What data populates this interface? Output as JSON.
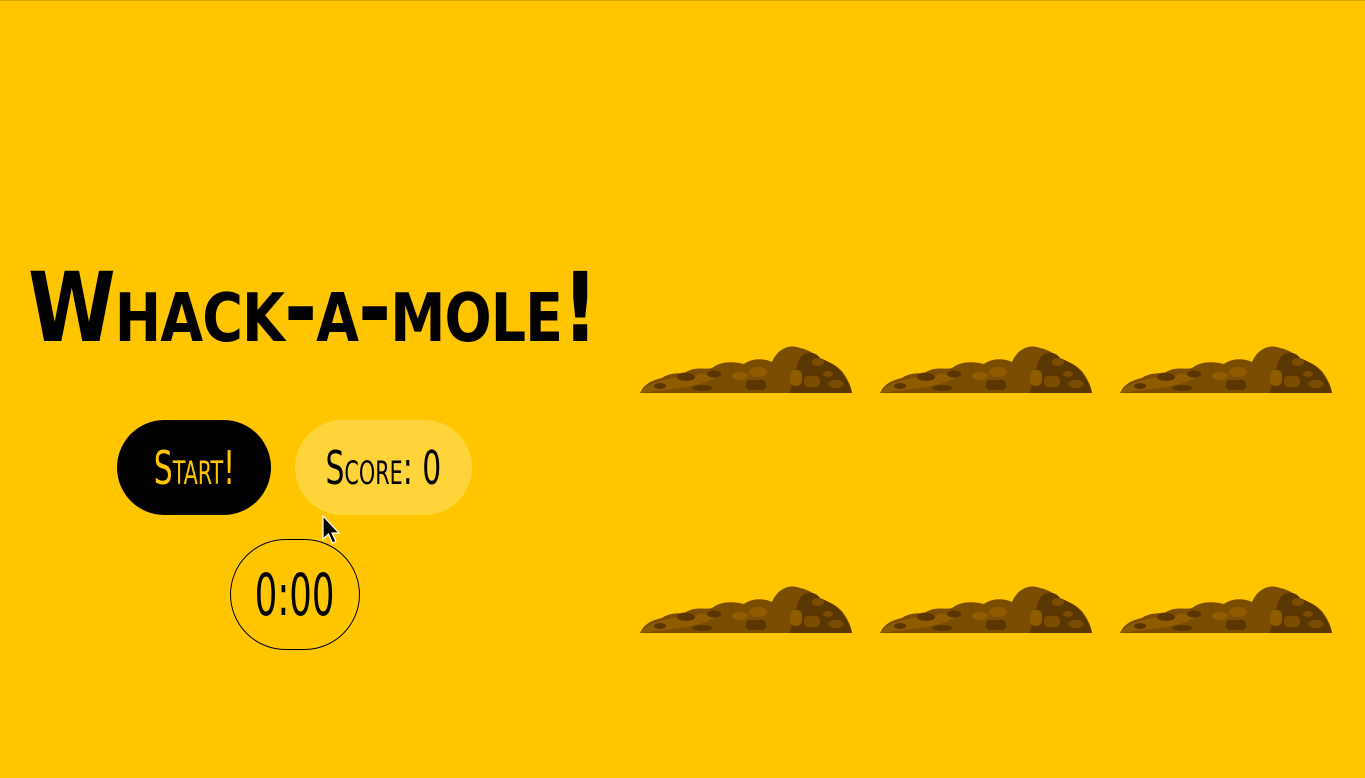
{
  "game": {
    "title": "Whack-a-mole!",
    "start_label": "Start!",
    "score_label": "Score: 0",
    "score": 0,
    "timer": "0:00"
  },
  "holes": [
    {
      "id": 1
    },
    {
      "id": 2
    },
    {
      "id": 3
    },
    {
      "id": 4
    },
    {
      "id": 5
    },
    {
      "id": 6
    }
  ],
  "colors": {
    "background": "#ffc600",
    "button_bg": "#000000",
    "button_text": "#ffc600",
    "score_bg": "#ffd43a",
    "dirt_dark": "#5a3600",
    "dirt_mid": "#7a4d00",
    "dirt_light": "#8f5c00"
  }
}
